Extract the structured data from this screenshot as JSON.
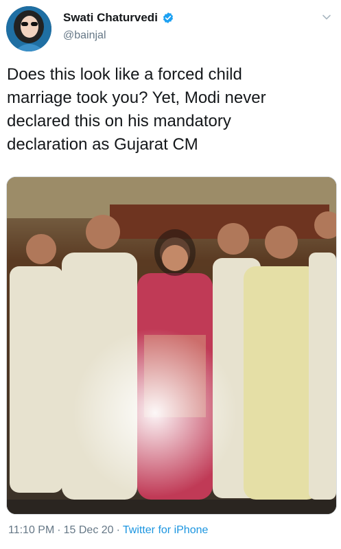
{
  "author": {
    "display_name": "Swati Chaturvedi",
    "handle": "@bainjal",
    "verified": true,
    "avatar_icon": "user-avatar"
  },
  "tweet": {
    "text": "Does this look like a forced child\nmarriage took you? Yet, Modi never\ndeclared this on his mandatory\ndeclaration as Gujarat CM"
  },
  "meta": {
    "time": "11:10 PM",
    "separator": "·",
    "date": "15 Dec 20",
    "source": "Twitter for iPhone"
  },
  "colors": {
    "text": "#14171a",
    "secondary": "#657786",
    "link": "#1b95e0",
    "verified_badge": "#1da1f2"
  },
  "icons": {
    "verified": "verified-badge-icon",
    "more": "chevron-down-icon"
  }
}
